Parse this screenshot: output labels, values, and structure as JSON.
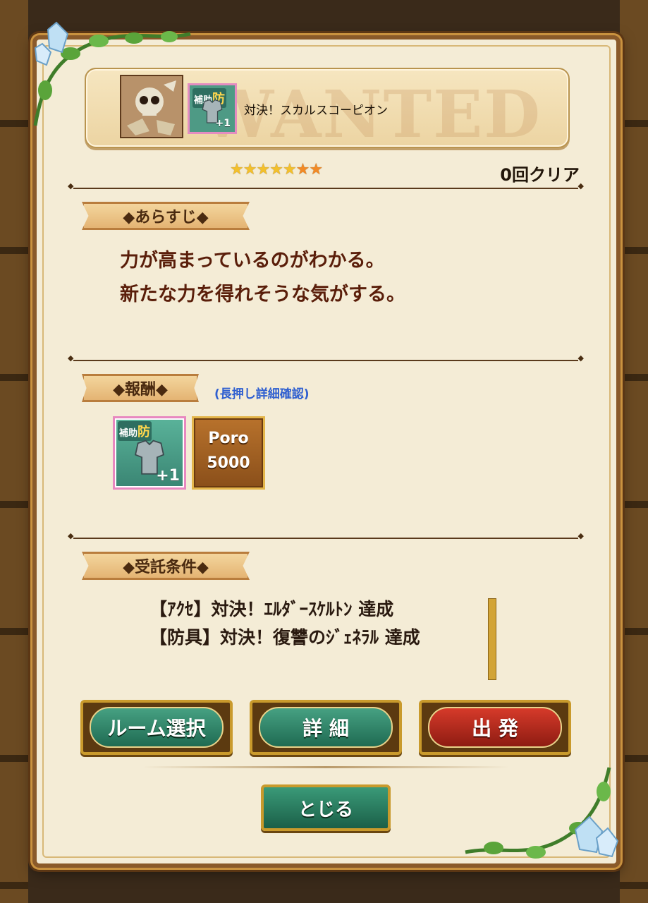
{
  "quest": {
    "title": "対決！スカルスコーピオン",
    "watermark": "WANTED",
    "stars": [
      "★",
      "★",
      "★",
      "★",
      "★",
      "★",
      "★"
    ],
    "clear_count": "0回クリア"
  },
  "sections": {
    "synopsis_header": "◆あらすじ◆",
    "synopsis_lines": [
      "力が高まっているのがわかる。",
      "新たな力を得れそうな気がする。"
    ],
    "reward_header": "◆報酬◆",
    "reward_hint": "(長押し詳細確認)",
    "conditions_header": "◆受託条件◆",
    "conditions": [
      "【ｱｸｾ】対決！ｴﾙﾀﾞｰｽｹﾙﾄﾝ 達成",
      "【防具】対決！復讐のｼﾞｪﾈﾗﾙ 達成"
    ]
  },
  "rewards": {
    "armor": {
      "tag": "補助",
      "tag_accent": "防",
      "plus": "+1"
    },
    "poro": {
      "label": "Poro",
      "amount": "5000"
    }
  },
  "buttons": {
    "room_select": "ルーム選択",
    "detail": "詳 細",
    "depart": "出 発",
    "close": "とじる"
  }
}
